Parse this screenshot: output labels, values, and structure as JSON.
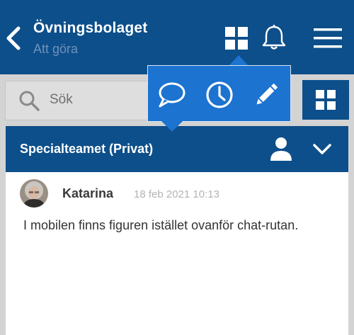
{
  "header": {
    "title": "Övningsbolaget",
    "subtitle": "Att göra",
    "icons": [
      "chevron-left-icon",
      "grid-icon",
      "bell-icon",
      "menu-icon"
    ]
  },
  "search": {
    "placeholder": "Sök"
  },
  "popup": {
    "actions": [
      "chat-icon",
      "clock-icon",
      "pencil-icon"
    ]
  },
  "chat": {
    "title": "Specialteamet (Privat)",
    "message": {
      "author": "Katarina",
      "timestamp": "18 feb 2021 10:13",
      "text": "I mobilen finns figuren istället ovanför chat-rutan."
    }
  },
  "colors": {
    "header": "#0d4f8a",
    "popup": "#1c73d0",
    "background": "#d3d3d3"
  }
}
